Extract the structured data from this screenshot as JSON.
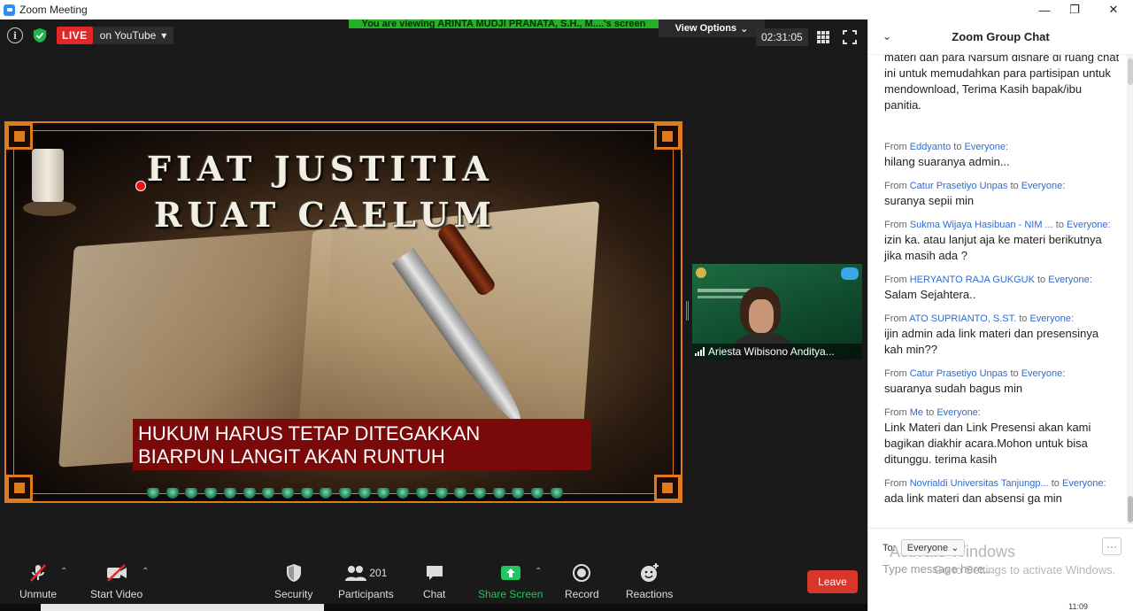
{
  "window": {
    "title": "Zoom Meeting",
    "minimize": "—",
    "maximize": "❐",
    "close": "✕"
  },
  "banner": {
    "viewing": "You are viewing ARINTA MUDJI PRANATA, S.H., M....'s screen",
    "view_options": "View Options"
  },
  "topbar": {
    "info": "i",
    "live": "LIVE",
    "stream": "on YouTube",
    "timer": "02:31:05"
  },
  "slide": {
    "title_line1": "FIAT JUSTITIA",
    "title_line2": "RUAT CAELUM",
    "caption_line1": "HUKUM HARUS TETAP DITEGAKKAN",
    "caption_line2": "BIARPUN LANGIT AKAN RUNTUH"
  },
  "participant": {
    "name": "Ariesta Wibisono Anditya..."
  },
  "toolbar": {
    "unmute": "Unmute",
    "start_video": "Start Video",
    "security": "Security",
    "participants": "Participants",
    "participants_count": "201",
    "chat": "Chat",
    "share_screen": "Share Screen",
    "record": "Record",
    "reactions": "Reactions",
    "leave": "Leave"
  },
  "chat": {
    "header": "Zoom Group Chat",
    "first_text": "materi dan para Narsum dishare di ruang chat ini untuk memudahkan para partisipan untuk mendownload, Terima Kasih bapak/ibu panitia.",
    "messages": [
      {
        "from": "From",
        "sender": "Eddyanto",
        "to": "to",
        "recipient": "Everyone:",
        "text": "hilang suaranya admin..."
      },
      {
        "from": "From",
        "sender": "Catur Prasetiyo Unpas",
        "to": "to",
        "recipient": "Everyone:",
        "text": "suranya sepii min"
      },
      {
        "from": "From",
        "sender": "Sukma Wijaya Hasibuan - NIM ...",
        "to": "to",
        "recipient": "Everyone:",
        "text": "izin ka. atau lanjut aja ke materi berikutnya jika masih ada ?"
      },
      {
        "from": "From",
        "sender": "HERYANTO RAJA GUKGUK",
        "to": "to",
        "recipient": "Everyone:",
        "text": "Salam Sejahtera.."
      },
      {
        "from": "From",
        "sender": "ATO SUPRIANTO, S.ST.",
        "to": "to",
        "recipient": "Everyone:",
        "text": "ijin admin ada link materi dan presensinya kah min??"
      },
      {
        "from": "From",
        "sender": "Catur Prasetiyo Unpas",
        "to": "to",
        "recipient": "Everyone:",
        "text": "suaranya sudah bagus min"
      },
      {
        "from": "From",
        "sender": "Me",
        "to": "to",
        "recipient": "Everyone:",
        "text": "Link Materi dan Link Presensi akan kami bagikan diakhir acara.Mohon untuk bisa ditunggu. terima kasih"
      },
      {
        "from": "From",
        "sender": "Novrialdi Universitas Tanjungp...",
        "to": "to",
        "recipient": "Everyone:",
        "text": "ada link materi dan absensi ga min"
      }
    ],
    "to_label": "To:",
    "to_value": "Everyone",
    "more": "···",
    "placeholder": "Type message here...",
    "watermark_line1": "Activate Windows",
    "watermark_line2": "Go to Settings to activate Windows.",
    "clock": "11:09"
  },
  "colors": {
    "live": "#e02828",
    "banner_green": "#25b028",
    "share_green": "#22c55e",
    "leave_red": "#d9362b",
    "chat_link": "#2d6cd0",
    "slide_border": "#e07a1f"
  }
}
